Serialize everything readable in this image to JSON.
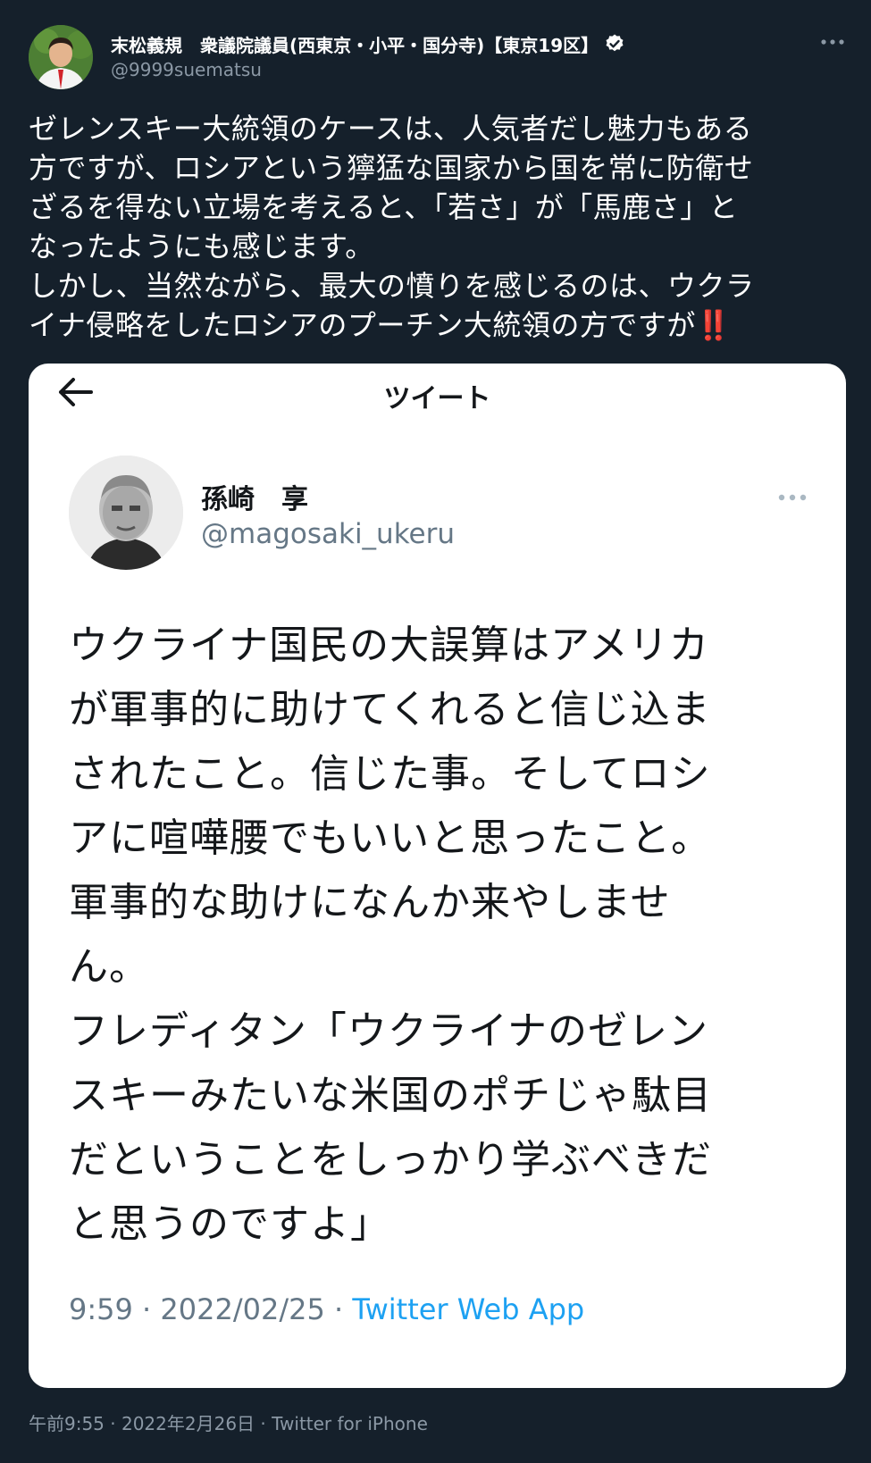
{
  "tweet": {
    "author": {
      "display_name": "末松義規　衆議院議員(西東京・小平・国分寺)【東京19区】",
      "handle": "@9999suematsu",
      "avatar_icon": "user-avatar",
      "verified_icon": "verified-badge-icon"
    },
    "text_lines": [
      "ゼレンスキー大統領のケースは、人気者だし魅力もある",
      "方ですが、ロシアという獰猛な国家から国を常に防衛せ",
      "ざるを得ない立場を考えると、「若さ」が「馬鹿さ」と",
      "なったようにも感じます。",
      "しかし、当然ながら、最大の憤りを感じるのは、ウクラ",
      "イナ侵略をしたロシアのプーチン大統領の方ですが"
    ],
    "emoji": "‼️",
    "meta": "午前9:55 · 2022年2月26日 · Twitter for iPhone"
  },
  "embedded": {
    "header_title": "ツイート",
    "back_icon": "back-arrow-icon",
    "author": {
      "display_name": "孫崎　享",
      "handle": "@magosaki_ukeru"
    },
    "text_lines": [
      "ウクライナ国民の大誤算はアメリカ",
      "が軍事的に助けてくれると信じ込ま",
      "されたこと。信じた事。そしてロシ",
      "アに喧嘩腰でもいいと思ったこと。",
      "軍事的な助けになんか来やしませ",
      "ん。",
      "フレディタン「ウクライナのゼレン",
      "スキーみたいな米国のポチじゃ駄目",
      "だということをしっかり学ぶべきだ",
      "と思うのですよ」"
    ],
    "time": "9:59 · 2022/02/25 · ",
    "app": "Twitter Web App"
  },
  "colors": {
    "background": "#15202b",
    "secondary_text": "#8b98a5",
    "accent": "#1da1f2",
    "emoji_red": "#e0245e"
  }
}
